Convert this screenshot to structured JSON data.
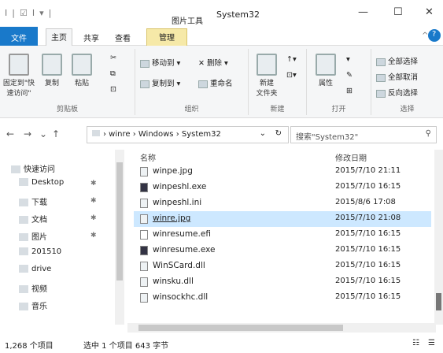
{
  "titlebar": {
    "qat": [
      "I",
      "|",
      "☑",
      "I",
      "▾",
      "|"
    ],
    "context_tab_label": "图片工具",
    "title": "System32",
    "minimize": "—",
    "maximize": "☐",
    "close": "✕"
  },
  "tabs": {
    "file": "文件",
    "home": "主页",
    "share": "共享",
    "view": "查看",
    "manage": "管理",
    "collapse": "^",
    "help": "?"
  },
  "ribbon": {
    "clipboard": {
      "pin": "固定到\"快\n速访问\"",
      "copy": "复制",
      "paste": "粘贴",
      "cut": "✂",
      "copy_path": "⧉",
      "paste_shortcut": "⊡",
      "label": "剪贴板"
    },
    "organize": {
      "move_to": "移动到 ▾",
      "delete": "✕ 删除 ▾",
      "copy_to": "复制到 ▾",
      "rename": "重命名",
      "label": "组织"
    },
    "new": {
      "new_folder": "新建\n文件夹",
      "new_item": "↑▾",
      "easy_access": "⊡▾",
      "label": "新建"
    },
    "open": {
      "properties": "属性",
      "open": "▾",
      "edit": "✎",
      "history": "⊞",
      "label": "打开"
    },
    "select": {
      "select_all": "全部选择",
      "select_none": "全部取消",
      "invert": "反向选择",
      "label": "选择"
    }
  },
  "address": {
    "back": "←",
    "forward": "→",
    "recent": "⌄",
    "up": "↑",
    "path": "›  winre  ›  Windows  ›  System32",
    "dropdown": "⌄",
    "refresh": "↻",
    "search_placeholder": "搜索\"System32\"",
    "search_icon": "⚲"
  },
  "nav": {
    "items": [
      {
        "label": "快速访问",
        "icon": "star-icon",
        "pinned": false
      },
      {
        "label": "Desktop",
        "icon": "folder-icon",
        "pinned": true
      },
      {
        "label": "下载",
        "icon": "download-icon",
        "pinned": true
      },
      {
        "label": "文档",
        "icon": "document-icon",
        "pinned": true
      },
      {
        "label": "图片",
        "icon": "picture-icon",
        "pinned": true
      },
      {
        "label": "201510",
        "icon": "folder-icon",
        "pinned": false
      },
      {
        "label": "drive",
        "icon": "folder-icon",
        "pinned": false
      },
      {
        "label": "视频",
        "icon": "video-icon",
        "pinned": false
      },
      {
        "label": "音乐",
        "icon": "music-icon",
        "pinned": false
      }
    ],
    "pin_glyph": "✱"
  },
  "list": {
    "headers": {
      "name": "名称",
      "modified": "修改日期"
    },
    "rows": [
      {
        "name": "winpe.jpg",
        "date": "2015/7/10 21:11",
        "icon": "image-file-icon"
      },
      {
        "name": "winpeshl.exe",
        "date": "2015/7/10 16:15",
        "icon": "exe-file-icon"
      },
      {
        "name": "winpeshl.ini",
        "date": "2015/8/6 17:08",
        "icon": "ini-file-icon"
      },
      {
        "name": "winre.jpg",
        "date": "2015/7/10 21:08",
        "icon": "image-file-icon",
        "selected": true
      },
      {
        "name": "winresume.efi",
        "date": "2015/7/10 16:15",
        "icon": "efi-file-icon"
      },
      {
        "name": "winresume.exe",
        "date": "2015/7/10 16:15",
        "icon": "exe-file-icon"
      },
      {
        "name": "WinSCard.dll",
        "date": "2015/7/10 16:15",
        "icon": "dll-file-icon"
      },
      {
        "name": "winsku.dll",
        "date": "2015/7/10 16:15",
        "icon": "dll-file-icon"
      },
      {
        "name": "winsockhc.dll",
        "date": "2015/7/10 16:15",
        "icon": "dll-file-icon"
      }
    ]
  },
  "status": {
    "count": "1,268 个项目",
    "selection": "选中 1 个项目  643 字节",
    "view_details": "☷",
    "view_tiles": "☰"
  }
}
